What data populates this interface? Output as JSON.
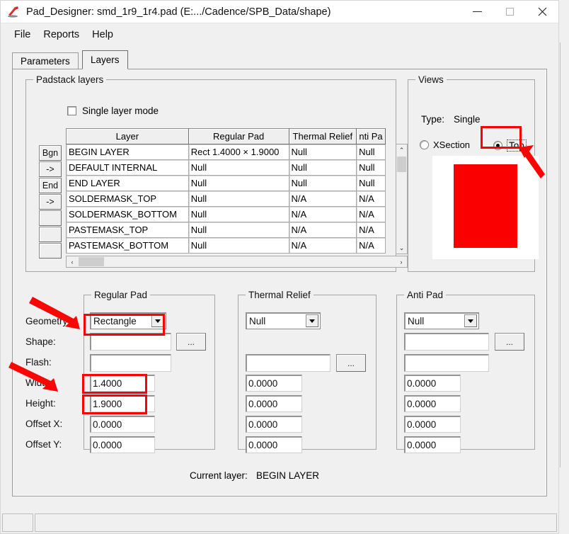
{
  "window": {
    "title": "Pad_Designer: smd_1r9_1r4.pad (E:.../Cadence/SPB_Data/shape)",
    "icon": "cadence-app-icon",
    "minimize": "–",
    "maximize": "□",
    "close": "✕"
  },
  "menubar": {
    "items": [
      {
        "label": "File"
      },
      {
        "label": "Reports"
      },
      {
        "label": "Help"
      }
    ]
  },
  "tabs": [
    {
      "label": "Parameters",
      "active": false
    },
    {
      "label": "Layers",
      "active": true
    }
  ],
  "padstack_layers": {
    "legend": "Padstack layers",
    "single_layer_mode": {
      "label": "Single layer mode",
      "checked": false
    },
    "columns": [
      "Layer",
      "Regular Pad",
      "Thermal Relief",
      "nti Pa"
    ],
    "side_buttons": [
      "Bgn",
      "->",
      "End",
      "->",
      "",
      "",
      ""
    ],
    "rows": [
      {
        "layer": "BEGIN LAYER",
        "regular_pad": "Rect 1.4000 × 1.9000",
        "thermal_relief": "Null",
        "anti_pad": "Null"
      },
      {
        "layer": "DEFAULT INTERNAL",
        "regular_pad": "Null",
        "thermal_relief": "Null",
        "anti_pad": "Null"
      },
      {
        "layer": "END LAYER",
        "regular_pad": "Null",
        "thermal_relief": "Null",
        "anti_pad": "Null"
      },
      {
        "layer": "SOLDERMASK_TOP",
        "regular_pad": "Null",
        "thermal_relief": "N/A",
        "anti_pad": "N/A"
      },
      {
        "layer": "SOLDERMASK_BOTTOM",
        "regular_pad": "Null",
        "thermal_relief": "N/A",
        "anti_pad": "N/A"
      },
      {
        "layer": "PASTEMASK_TOP",
        "regular_pad": "Null",
        "thermal_relief": "N/A",
        "anti_pad": "N/A"
      },
      {
        "layer": "PASTEMASK_BOTTOM",
        "regular_pad": "Null",
        "thermal_relief": "N/A",
        "anti_pad": "N/A"
      }
    ],
    "scroll_up": "⌃",
    "scroll_down": "⌄",
    "scroll_left": "‹",
    "scroll_right": "›"
  },
  "views": {
    "legend": "Views",
    "type_label": "Type:",
    "type_value": "Single",
    "radios": [
      {
        "label": "XSection",
        "selected": false
      },
      {
        "label": "Top",
        "selected": true
      }
    ],
    "pad_color": "#fb0000",
    "canvas_color": "#ffffff"
  },
  "regular_pad": {
    "legend": "Regular Pad",
    "labels": {
      "geometry": "Geometry:",
      "shape": "Shape:",
      "flash": "Flash:",
      "width": "Width:",
      "height": "Height:",
      "offset_x": "Offset X:",
      "offset_y": "Offset Y:"
    },
    "geometry": "Rectangle",
    "shape": "",
    "flash": "",
    "width": "1.4000",
    "height": "1.9000",
    "offset_x": "0.0000",
    "offset_y": "0.0000",
    "browse_button": "..."
  },
  "thermal_relief": {
    "legend": "Thermal Relief",
    "geometry": "Null",
    "flash": "",
    "width": "0.0000",
    "height": "0.0000",
    "offset_x": "0.0000",
    "offset_y": "0.0000",
    "browse_button": "..."
  },
  "anti_pad": {
    "legend": "Anti Pad",
    "geometry": "Null",
    "shape": "",
    "flash": "",
    "width": "0.0000",
    "height": "0.0000",
    "offset_x": "0.0000",
    "offset_y": "0.0000",
    "browse_button": "..."
  },
  "current_layer": {
    "label": "Current layer:",
    "value": "BEGIN LAYER"
  },
  "annotations": {
    "color": "#ff0000",
    "highlights": [
      "top-radio-highlight",
      "geometry-combo-highlight",
      "width-field-highlight",
      "height-field-highlight"
    ],
    "arrows": [
      "arrow-to-top-radio",
      "arrow-to-geometry",
      "arrow-to-width"
    ]
  },
  "statusbar": {
    "left_cell": "",
    "right_cell": ""
  }
}
